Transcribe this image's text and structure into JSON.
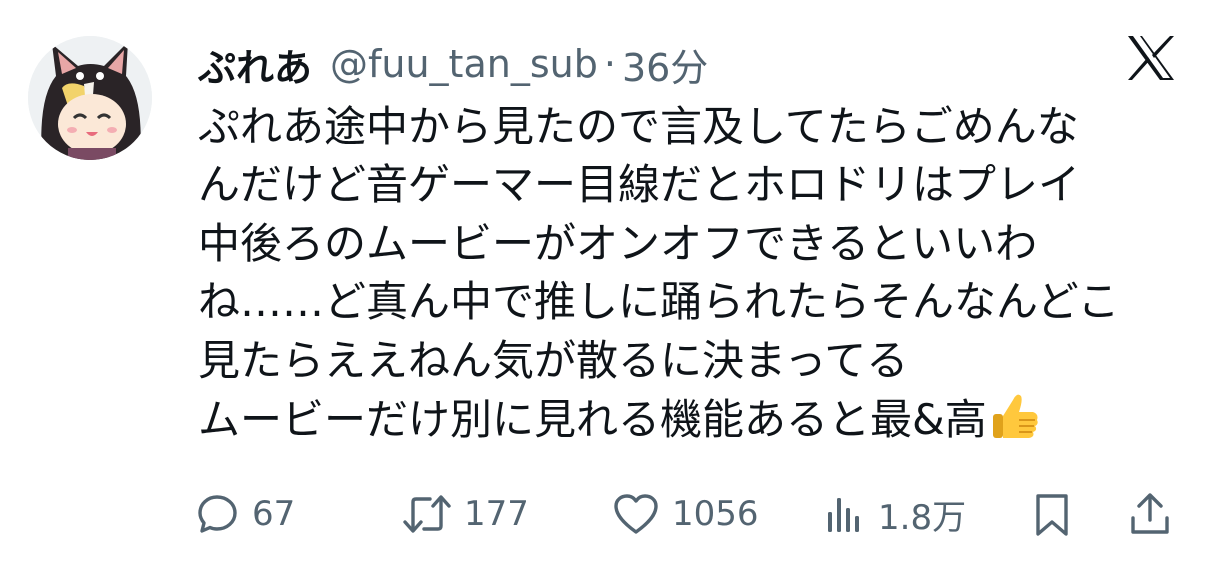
{
  "tweet": {
    "display_name": "ぷれあ",
    "handle": "@fuu_tan_sub",
    "separator": "·",
    "timestamp": "36分",
    "lines": [
      "ぷれあ途中から見たので言及してたらごめんな",
      "んだけど音ゲーマー目線だとホロドリはプレイ",
      "中後ろのムービーがオンオフできるといいわ",
      "ね……ど真ん中で推しに踊られたらそんなんどこ",
      "見たらええねん気が散るに決まってる",
      "ムービーだけ別に見れる機能あると最&高"
    ],
    "emoji": "thumbs-up"
  },
  "actions": {
    "reply_count": "67",
    "retweet_count": "177",
    "like_count": "1056",
    "views_count": "1.8万"
  },
  "colors": {
    "text": "#0f1419",
    "secondary": "#536471",
    "background": "#ffffff"
  },
  "icons": [
    "x-logo",
    "reply-icon",
    "retweet-icon",
    "like-icon",
    "views-icon",
    "bookmark-icon",
    "share-icon",
    "thumbs-up-emoji"
  ]
}
